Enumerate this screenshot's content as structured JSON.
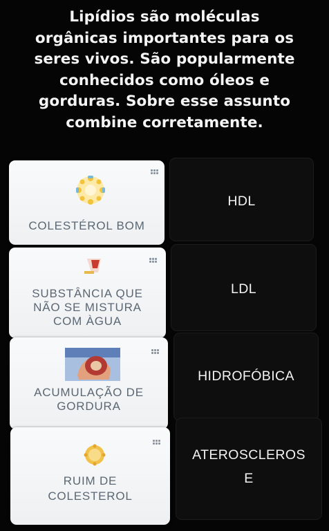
{
  "question": {
    "lines": [
      "Lipídios são moléculas",
      "orgânicas importantes para os",
      "seres vivos. São popularmente",
      "conhecidos como óleos e",
      "gorduras. Sobre esse assunto",
      "combine corretamente."
    ]
  },
  "left_cards": [
    {
      "lines": [
        "COLESTÉROL BOM"
      ],
      "image": "cholesterol-molecule"
    },
    {
      "lines": [
        "SUBSTÂNCIA QUE",
        "NÃO SE MISTURA",
        "COM ÀGUA"
      ],
      "image": "water-glass"
    },
    {
      "lines": [
        "ACUMULAÇÃO DE",
        "GORDURA"
      ],
      "image": "artery-plaque"
    },
    {
      "lines": [
        "RUIM DE",
        "COLESTEROL"
      ],
      "image": "lipoprotein-particle"
    }
  ],
  "right_cards": [
    {
      "lines": [
        "HDL"
      ]
    },
    {
      "lines": [
        "LDL"
      ]
    },
    {
      "lines": [
        "HIDROFÓBICA"
      ]
    },
    {
      "lines": [
        "ATEROSCLEROS",
        "E"
      ]
    }
  ],
  "colors": {
    "background": "#050505",
    "left_card": "#f6f7f8",
    "left_text": "#5b6773",
    "right_card": "#0e0e0e",
    "right_text": "#f3f3f3"
  }
}
